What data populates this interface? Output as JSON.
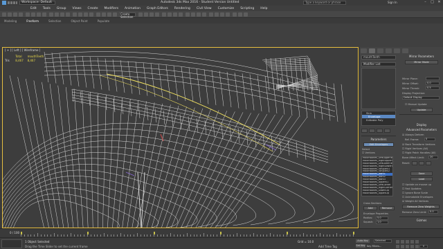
{
  "titlebar": {
    "workspace": "Workspace: Default",
    "title": "Autodesk 3ds Max 2016 - Student Version   Untitled",
    "search_placeholder": "Type a keyword or phrase",
    "sign_in": "Sign In"
  },
  "menubar": [
    "Edit",
    "Tools",
    "Group",
    "Views",
    "Create",
    "Modifiers",
    "Animation",
    "Graph Editors",
    "Rendering",
    "Civil View",
    "Customize",
    "Scripting",
    "Help"
  ],
  "toolbar": {
    "selection_set": "Create Selection Se"
  },
  "ribbon_tabs": [
    {
      "label": "Modeling",
      "active": false
    },
    {
      "label": "Freeform",
      "active": true
    },
    {
      "label": "Selection",
      "active": false
    },
    {
      "label": "Object Paint",
      "active": false
    },
    {
      "label": "Populate",
      "active": false
    }
  ],
  "viewport": {
    "label": "[ + ] [ Left ] [ Wireframe ]",
    "stats_header": [
      "Total",
      "mouthTeeth"
    ],
    "stats_rows": [
      {
        "k": "Tris",
        "a": "8,467",
        "b": "8,467"
      }
    ]
  },
  "command_panel": {
    "object_name": "mouthTeeth",
    "modifier_list": "Modifier List",
    "stack": [
      {
        "label": "Skin",
        "highlight": false,
        "sub": false
      },
      {
        "label": "Envelope",
        "highlight": true,
        "sub": true
      },
      {
        "label": "Editable Poly",
        "highlight": false,
        "sub": false
      }
    ],
    "mirror_params_title": "Mirror Parameters",
    "mirror_mode": "Mirror Mode",
    "mirror_plane_label": "Mirror Plane:",
    "mirror_offset_label": "Mirror Offset:",
    "mirror_offset_value": "0.0",
    "mirror_thresh_label": "Mirror Thresh:",
    "mirror_thresh_value": "0.5",
    "display_projection_label": "Display Projection:",
    "display_projection_value": "Default Display",
    "manual_update": "Manual Update",
    "update_btn": "Update",
    "params_title": "Parameters",
    "edit_envelopes": "Edit Envelopes",
    "select_label": "Select",
    "vertices": "Vertices",
    "select_element": "Select Element",
    "backface_cull": "Backface Cull Vertices",
    "envelopes_label": "Envelopes",
    "cross_sections": "Cross Sections",
    "bones_list": [
      {
        "label": "MouthBones_LeftUpperTeeth",
        "highlight": false
      },
      {
        "label": "MouthBones_RightUpperTeeth",
        "highlight": false
      },
      {
        "label": "MouthBones_LeftLowerTeeth",
        "highlight": false
      },
      {
        "label": "MouthBones_RightLowerTeeth",
        "highlight": false
      },
      {
        "label": "MouthBones_Tongue01",
        "highlight": false
      },
      {
        "label": "MouthBones_Tongue02",
        "highlight": false
      },
      {
        "label": "MouthBones_Jaw01",
        "highlight": true
      },
      {
        "label": "MouthBones_Jaw02",
        "highlight": false
      },
      {
        "label": "MouthBones_Jaw03",
        "highlight": false
      },
      {
        "label": "MouthBones_Upper01",
        "highlight": false
      },
      {
        "label": "MouthBones_LeftCorner",
        "highlight": false
      },
      {
        "label": "MouthBones_RightCorner",
        "highlight": false
      },
      {
        "label": "MouthBones_LowerLip",
        "highlight": false
      },
      {
        "label": "MouthBones_UpperLip",
        "highlight": false
      }
    ],
    "cross_section_title": "Cross Sections",
    "add_btn": "Add",
    "remove_btn": "Remove",
    "envelope_props_title": "Envelope Properties",
    "radius_label": "Radius:",
    "radius_value": "5.0",
    "squash_label": "Squash:",
    "squash_value": "1.0",
    "weight_props_title": "Weight Properties",
    "abs_effect_label": "Abs. Effect:",
    "abs_effect_value": "0.0",
    "rigid": "Rigid",
    "rigid_handles": "Rigid Handles",
    "normalize": "Normalize",
    "paint_weights": "Paint Weights",
    "weight_tool": "Weight Tool",
    "weight_table": "Weight Table",
    "paint_blend": "Paint Blend Weights",
    "display_title": "Display",
    "advanced_title": "Advanced Parameters",
    "always_deform": "Always Deform",
    "ref_frame_label": "Ref. Frame:",
    "ref_frame_value": "0",
    "back_transform": "Back Transform Vertices",
    "rigid_vertices": "Rigid Vertices (All)",
    "rigid_patch": "Rigid Patch Handles (All)",
    "bone_affect_label": "Bone Affect Limit:",
    "bone_affect_value": "20",
    "reset_label": "Reset:",
    "save_btn": "Save",
    "load_btn": "Load",
    "update_on_mouseup": "Update on mouse up",
    "fast_updates": "Fast Updates",
    "ignore_bone_scale": "Ignore Bone Scale",
    "animatable_envelopes": "Animatable Envelopes",
    "weight_all_vertices": "Weight All Vertices",
    "remove_zero_weights": "Remove Zero Weights",
    "remove_zero_limit_label": "Remove Zero Limit:",
    "remove_zero_limit_value": "0.0",
    "gizmos_title": "Gizmos"
  },
  "timeline": {
    "counter": "0 / 100"
  },
  "statusbar": {
    "selection": "1 Object Selected",
    "prompt": "Drag the Time Slider to set the current frame",
    "grid": "Grid = 10.0",
    "add_time_tag": "Add Time Tag",
    "auto_key": "Auto Key",
    "selected": "Selected",
    "set_key": "Set Key",
    "key_filters": "Key Filters...",
    "frame": "0"
  }
}
